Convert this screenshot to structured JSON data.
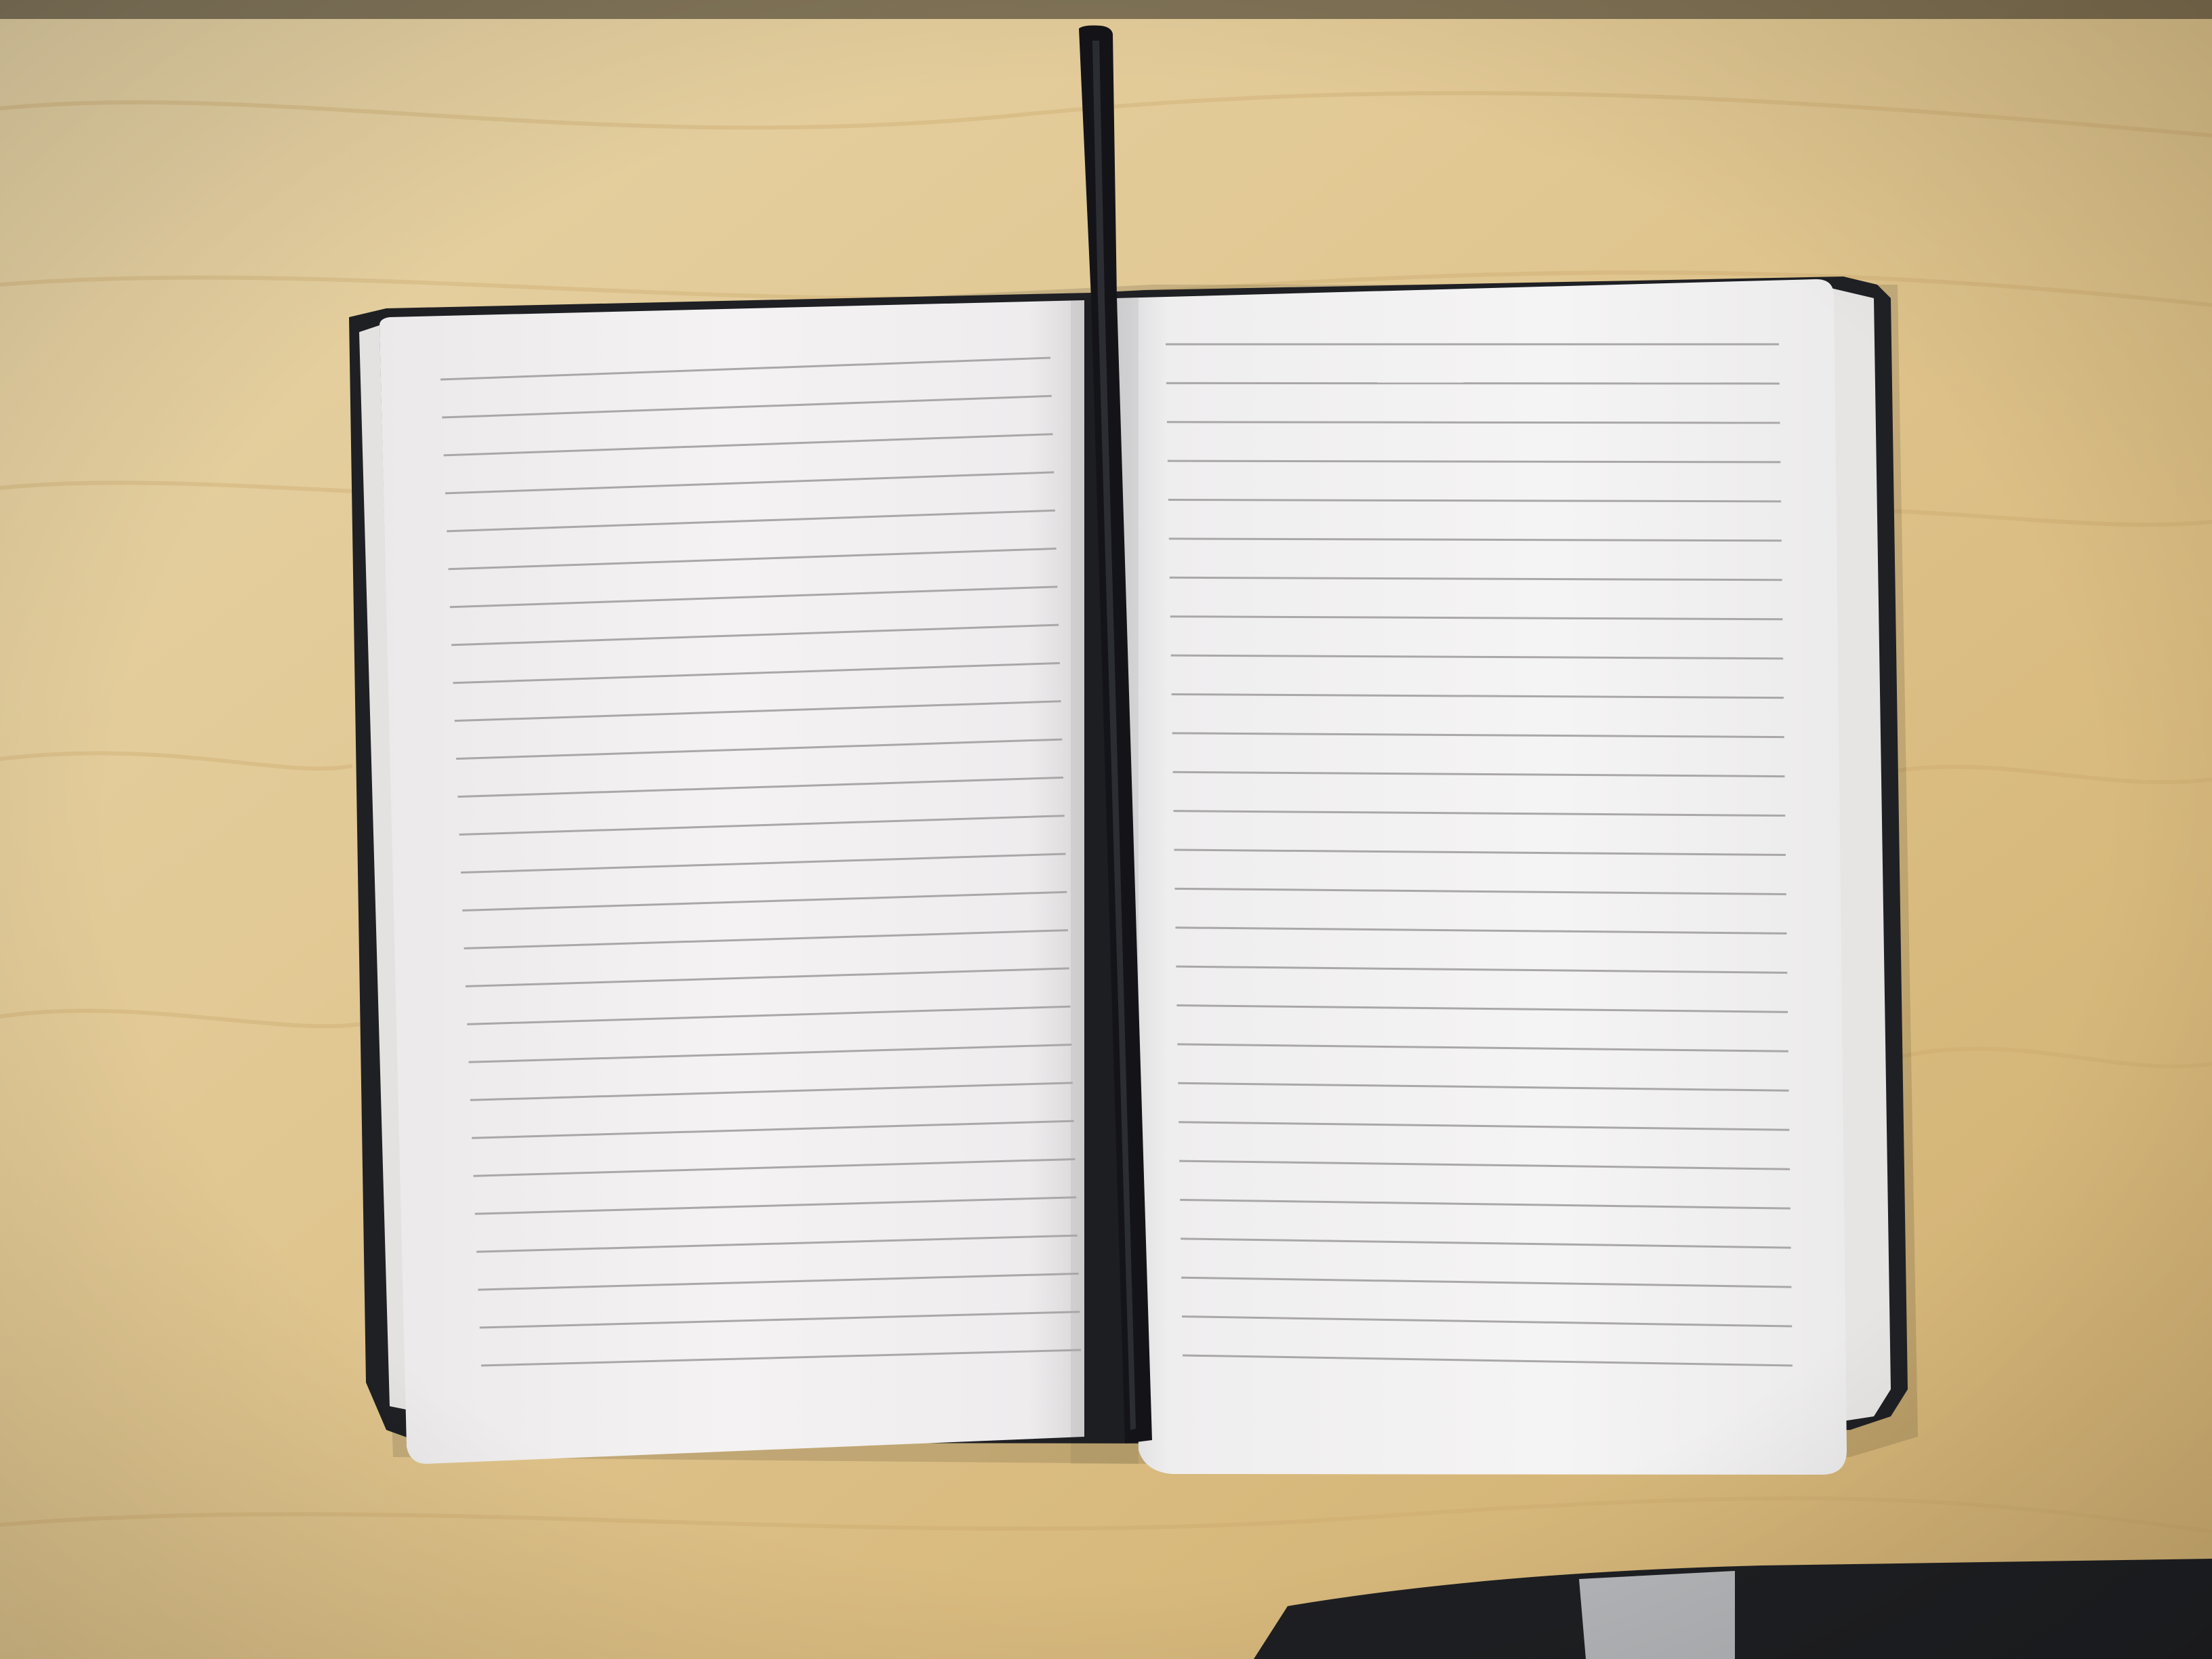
{
  "scene": {
    "subject": "open-lined-notebook",
    "surface": "light-wood-desk",
    "colors": {
      "wood": "#e3cb97",
      "wood_dark": "#c9a96c",
      "cover": "#1f2024",
      "page": "#f2f0ef",
      "rule_line": "#a8a6a6",
      "ribbon": "#141418"
    },
    "left_page": {
      "ruled_lines": 27
    },
    "right_page": {
      "ruled_lines": 27
    }
  }
}
